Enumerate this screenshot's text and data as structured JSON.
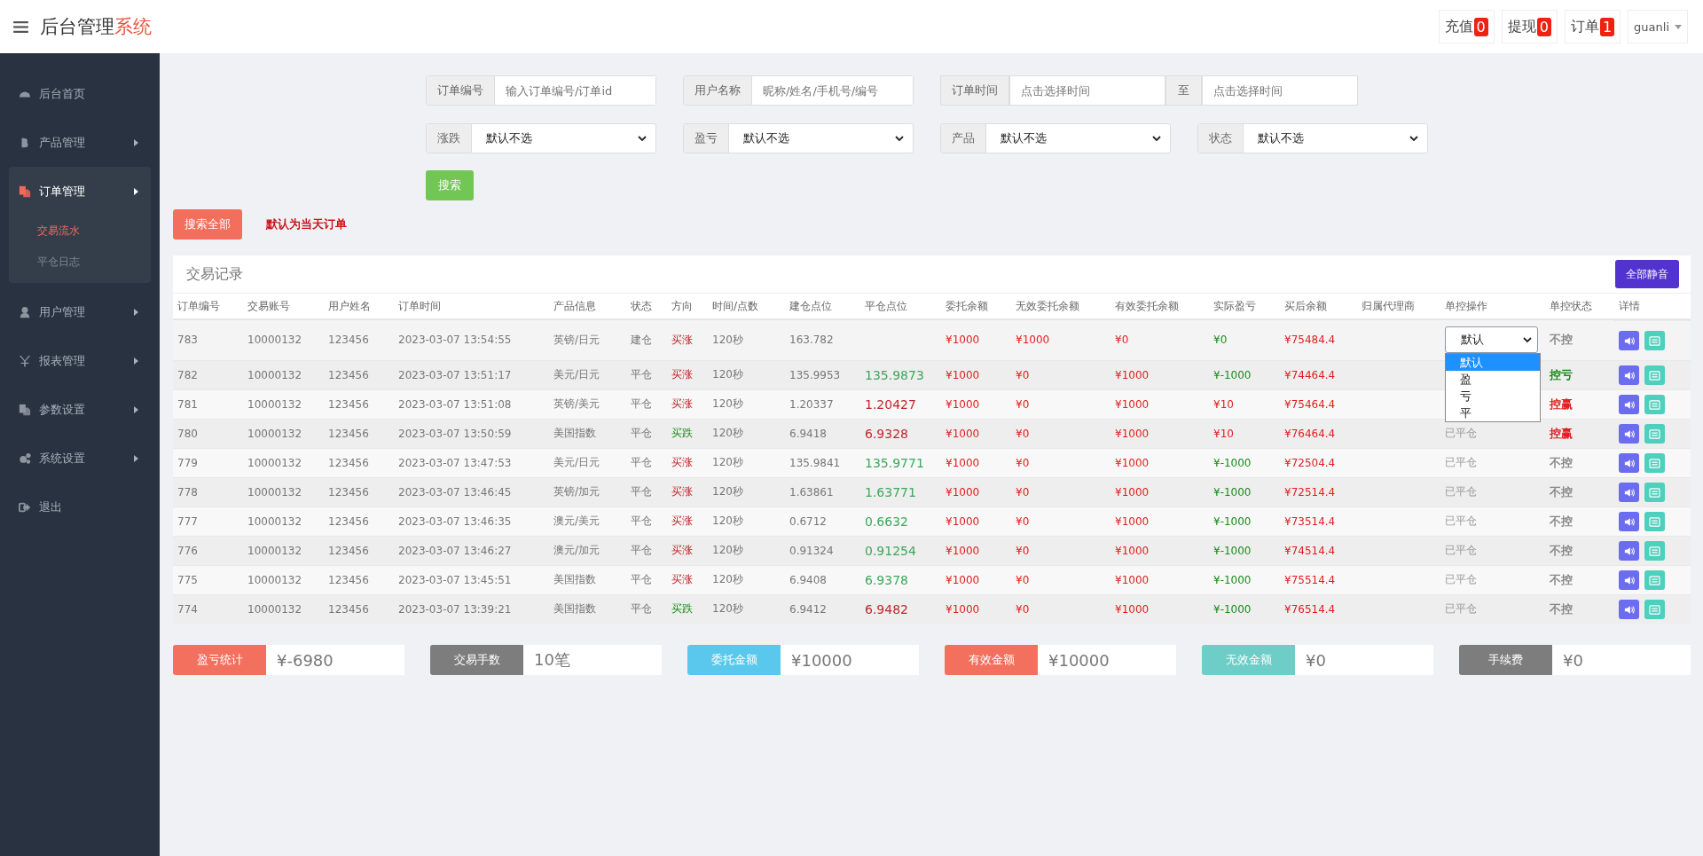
{
  "header": {
    "title": "后台管理",
    "title_accent": "系统",
    "badges": [
      {
        "label": "充值",
        "count": "0"
      },
      {
        "label": "提现",
        "count": "0"
      },
      {
        "label": "订单",
        "count": "1"
      }
    ],
    "user": "guanli"
  },
  "sidebar": {
    "items": [
      {
        "label": "后台首页",
        "expandable": false,
        "expanded": false
      },
      {
        "label": "产品管理",
        "expandable": true,
        "expanded": false
      },
      {
        "label": "订单管理",
        "expandable": true,
        "expanded": true,
        "children": [
          {
            "label": "交易流水",
            "selected": true
          },
          {
            "label": "平仓日志",
            "selected": false
          }
        ]
      },
      {
        "label": "用户管理",
        "expandable": true,
        "expanded": false
      },
      {
        "label": "报表管理",
        "expandable": true,
        "expanded": false
      },
      {
        "label": "参数设置",
        "expandable": true,
        "expanded": false
      },
      {
        "label": "系统设置",
        "expandable": true,
        "expanded": false
      },
      {
        "label": "退出",
        "expandable": false,
        "expanded": false
      }
    ]
  },
  "filters": {
    "row_1": [
      {
        "kind": "input",
        "label": "订单编号",
        "placeholder": "输入订单编号/订单id"
      },
      {
        "kind": "input",
        "label": "用户名称",
        "placeholder": "昵称/姓名/手机号/编号"
      },
      {
        "kind": "range",
        "label": "订单时间",
        "placeholder": "点击选择时间",
        "separator": "至",
        "placeholder_end": "点击选择时间"
      }
    ],
    "row_2": [
      {
        "kind": "select",
        "label": "涨跌",
        "value": "默认不选"
      },
      {
        "kind": "select",
        "label": "盈亏",
        "value": "默认不选"
      },
      {
        "kind": "select",
        "label": "产品",
        "value": "默认不选"
      },
      {
        "kind": "select",
        "label": "状态",
        "value": "默认不选"
      }
    ],
    "search_button": "搜索"
  },
  "search_all_button": "搜索全部",
  "notice": "默认为当天订单",
  "table": {
    "title": "交易记录",
    "mute_all_button": "全部静音",
    "columns": [
      "订单编号",
      "交易账号",
      "用户姓名",
      "订单时间",
      "产品信息",
      "状态",
      "方向",
      "时间/点数",
      "建仓点位",
      "平仓点位",
      "委托余额",
      "无效委托余额",
      "有效委托余额",
      "实际盈亏",
      "买后余额",
      "归属代理商",
      "单控操作",
      "单控状态",
      "详情"
    ],
    "rows": [
      {
        "id": "783",
        "account": "10000132",
        "user": "123456",
        "time": "2023-03-07 13:54:55",
        "product": "英镑/日元",
        "state": "建仓",
        "direction": {
          "text": "买涨",
          "color": "#c0262c"
        },
        "duration": "120秒",
        "open": "163.782",
        "entrust": "¥1000",
        "invalid": "¥1000",
        "valid": "¥0",
        "pnl": {
          "text": "¥0",
          "color": "#1c8a1c"
        },
        "balance": "¥75484.4",
        "control": {
          "kind": "select",
          "value": "默认"
        },
        "control_status": {
          "text": "不控",
          "color": "#888888"
        }
      },
      {
        "id": "782",
        "account": "10000132",
        "user": "123456",
        "time": "2023-03-07 13:51:17",
        "product": "美元/日元",
        "state": "平仓",
        "direction": {
          "text": "买涨",
          "color": "#c0262c"
        },
        "duration": "120秒",
        "open": "135.9953",
        "close": {
          "text": "135.9873",
          "color": "#3ca85a"
        },
        "entrust": "¥1000",
        "invalid": "¥0",
        "valid": "¥1000",
        "pnl": {
          "text": "¥-1000",
          "color": "#1c8a1c"
        },
        "balance": "¥74464.4",
        "control_status": {
          "text": "控亏",
          "color": "#1c8a1c"
        }
      },
      {
        "id": "781",
        "account": "10000132",
        "user": "123456",
        "time": "2023-03-07 13:51:08",
        "product": "英镑/美元",
        "state": "平仓",
        "direction": {
          "text": "买涨",
          "color": "#c0262c"
        },
        "duration": "120秒",
        "open": "1.20337",
        "close": {
          "text": "1.20427",
          "color": "#c0262c"
        },
        "entrust": "¥1000",
        "invalid": "¥0",
        "valid": "¥1000",
        "pnl": {
          "text": "¥10",
          "color": "#e02020"
        },
        "balance": "¥75464.4",
        "control_status": {
          "text": "控赢",
          "color": "#e02020"
        }
      },
      {
        "id": "780",
        "account": "10000132",
        "user": "123456",
        "time": "2023-03-07 13:50:59",
        "product": "美国指数",
        "state": "平仓",
        "direction": {
          "text": "买跌",
          "color": "#1c8a1c"
        },
        "duration": "120秒",
        "open": "6.9418",
        "close": {
          "text": "6.9328",
          "color": "#c0262c"
        },
        "entrust": "¥1000",
        "invalid": "¥0",
        "valid": "¥1000",
        "pnl": {
          "text": "¥10",
          "color": "#e02020"
        },
        "balance": "¥76464.4",
        "control": {
          "kind": "text",
          "value": "已平仓"
        },
        "control_status": {
          "text": "控赢",
          "color": "#e02020"
        }
      },
      {
        "id": "779",
        "account": "10000132",
        "user": "123456",
        "time": "2023-03-07 13:47:53",
        "product": "美元/日元",
        "state": "平仓",
        "direction": {
          "text": "买涨",
          "color": "#c0262c"
        },
        "duration": "120秒",
        "open": "135.9841",
        "close": {
          "text": "135.9771",
          "color": "#3ca85a"
        },
        "entrust": "¥1000",
        "invalid": "¥0",
        "valid": "¥1000",
        "pnl": {
          "text": "¥-1000",
          "color": "#1c8a1c"
        },
        "balance": "¥72504.4",
        "control": {
          "kind": "text",
          "value": "已平仓"
        },
        "control_status": {
          "text": "不控",
          "color": "#888888"
        }
      },
      {
        "id": "778",
        "account": "10000132",
        "user": "123456",
        "time": "2023-03-07 13:46:45",
        "product": "英镑/加元",
        "state": "平仓",
        "direction": {
          "text": "买涨",
          "color": "#c0262c"
        },
        "duration": "120秒",
        "open": "1.63861",
        "close": {
          "text": "1.63771",
          "color": "#3ca85a"
        },
        "entrust": "¥1000",
        "invalid": "¥0",
        "valid": "¥1000",
        "pnl": {
          "text": "¥-1000",
          "color": "#1c8a1c"
        },
        "balance": "¥72514.4",
        "control": {
          "kind": "text",
          "value": "已平仓"
        },
        "control_status": {
          "text": "不控",
          "color": "#888888"
        }
      },
      {
        "id": "777",
        "account": "10000132",
        "user": "123456",
        "time": "2023-03-07 13:46:35",
        "product": "澳元/美元",
        "state": "平仓",
        "direction": {
          "text": "买涨",
          "color": "#c0262c"
        },
        "duration": "120秒",
        "open": "0.6712",
        "close": {
          "text": "0.6632",
          "color": "#3ca85a"
        },
        "entrust": "¥1000",
        "invalid": "¥0",
        "valid": "¥1000",
        "pnl": {
          "text": "¥-1000",
          "color": "#1c8a1c"
        },
        "balance": "¥73514.4",
        "control": {
          "kind": "text",
          "value": "已平仓"
        },
        "control_status": {
          "text": "不控",
          "color": "#888888"
        }
      },
      {
        "id": "776",
        "account": "10000132",
        "user": "123456",
        "time": "2023-03-07 13:46:27",
        "product": "澳元/加元",
        "state": "平仓",
        "direction": {
          "text": "买涨",
          "color": "#c0262c"
        },
        "duration": "120秒",
        "open": "0.91324",
        "close": {
          "text": "0.91254",
          "color": "#3ca85a"
        },
        "entrust": "¥1000",
        "invalid": "¥0",
        "valid": "¥1000",
        "pnl": {
          "text": "¥-1000",
          "color": "#1c8a1c"
        },
        "balance": "¥74514.4",
        "control": {
          "kind": "text",
          "value": "已平仓"
        },
        "control_status": {
          "text": "不控",
          "color": "#888888"
        }
      },
      {
        "id": "775",
        "account": "10000132",
        "user": "123456",
        "time": "2023-03-07 13:45:51",
        "product": "美国指数",
        "state": "平仓",
        "direction": {
          "text": "买涨",
          "color": "#c0262c"
        },
        "duration": "120秒",
        "open": "6.9408",
        "close": {
          "text": "6.9378",
          "color": "#3ca85a"
        },
        "entrust": "¥1000",
        "invalid": "¥0",
        "valid": "¥1000",
        "pnl": {
          "text": "¥-1000",
          "color": "#1c8a1c"
        },
        "balance": "¥75514.4",
        "control": {
          "kind": "text",
          "value": "已平仓"
        },
        "control_status": {
          "text": "不控",
          "color": "#888888"
        }
      },
      {
        "id": "774",
        "account": "10000132",
        "user": "123456",
        "time": "2023-03-07 13:39:21",
        "product": "美国指数",
        "state": "平仓",
        "direction": {
          "text": "买跌",
          "color": "#1c8a1c"
        },
        "duration": "120秒",
        "open": "6.9412",
        "close": {
          "text": "6.9482",
          "color": "#c0262c"
        },
        "entrust": "¥1000",
        "invalid": "¥0",
        "valid": "¥1000",
        "pnl": {
          "text": "¥-1000",
          "color": "#1c8a1c"
        },
        "balance": "¥76514.4",
        "control": {
          "kind": "text",
          "value": "已平仓"
        },
        "control_status": {
          "text": "不控",
          "color": "#888888"
        }
      }
    ],
    "dropdown": {
      "options": [
        {
          "label": "默认",
          "selected": true
        },
        {
          "label": "盈",
          "selected": false
        },
        {
          "label": "亏",
          "selected": false
        },
        {
          "label": "平",
          "selected": false
        }
      ]
    }
  },
  "stats": [
    {
      "label": "盈亏统计",
      "value": "¥-6980",
      "color": "#f3705f"
    },
    {
      "label": "交易手数",
      "value": "10笔",
      "color": "#7d7d7d"
    },
    {
      "label": "委托金额",
      "value": "¥10000",
      "color": "#5ac8ec"
    },
    {
      "label": "有效金额",
      "value": "¥10000",
      "color": "#f3705f"
    },
    {
      "label": "无效金额",
      "value": "¥0",
      "color": "#6ecdc6"
    },
    {
      "label": "手续费",
      "value": "¥0",
      "color": "#7d7d7d"
    }
  ]
}
